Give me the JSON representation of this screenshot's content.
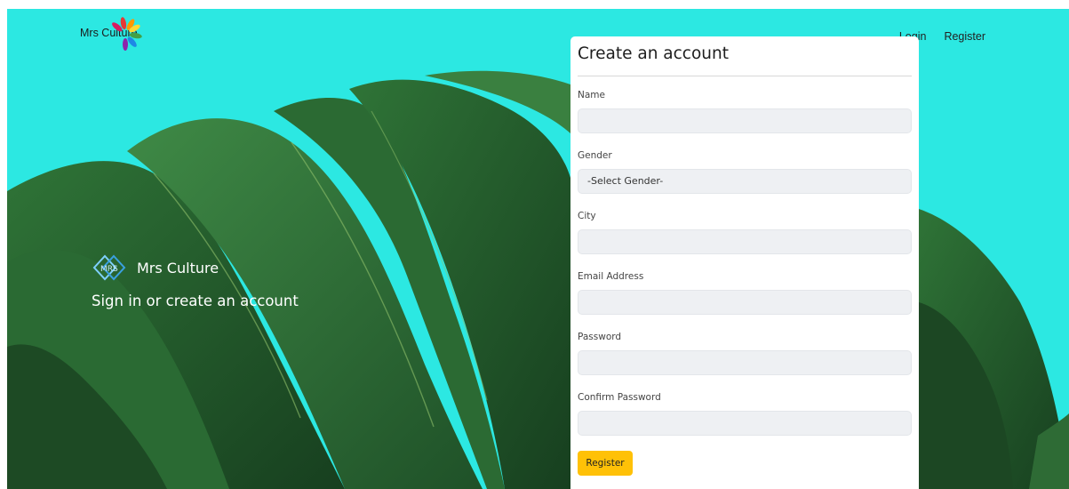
{
  "header": {
    "logo_text": "Mrs Culture",
    "nav": {
      "login": "Login",
      "register": "Register"
    }
  },
  "hero": {
    "brand_name": "Mrs Culture",
    "tagline": "Sign in or create an account"
  },
  "form": {
    "title": "Create an account",
    "fields": {
      "name": {
        "label": "Name",
        "value": ""
      },
      "gender": {
        "label": "Gender",
        "selected": "-Select Gender-"
      },
      "city": {
        "label": "City",
        "value": ""
      },
      "email": {
        "label": "Email Address",
        "value": ""
      },
      "password": {
        "label": "Password",
        "value": ""
      },
      "confirm_password": {
        "label": "Confirm Password",
        "value": ""
      }
    },
    "submit_label": "Register"
  },
  "colors": {
    "background": "#2ce8e2",
    "leaf": "#2e6b35",
    "button": "#ffc107",
    "input_bg": "#eef0f3"
  },
  "icons": [
    "flower-logo-icon",
    "mrs-diamond-logo-icon"
  ]
}
